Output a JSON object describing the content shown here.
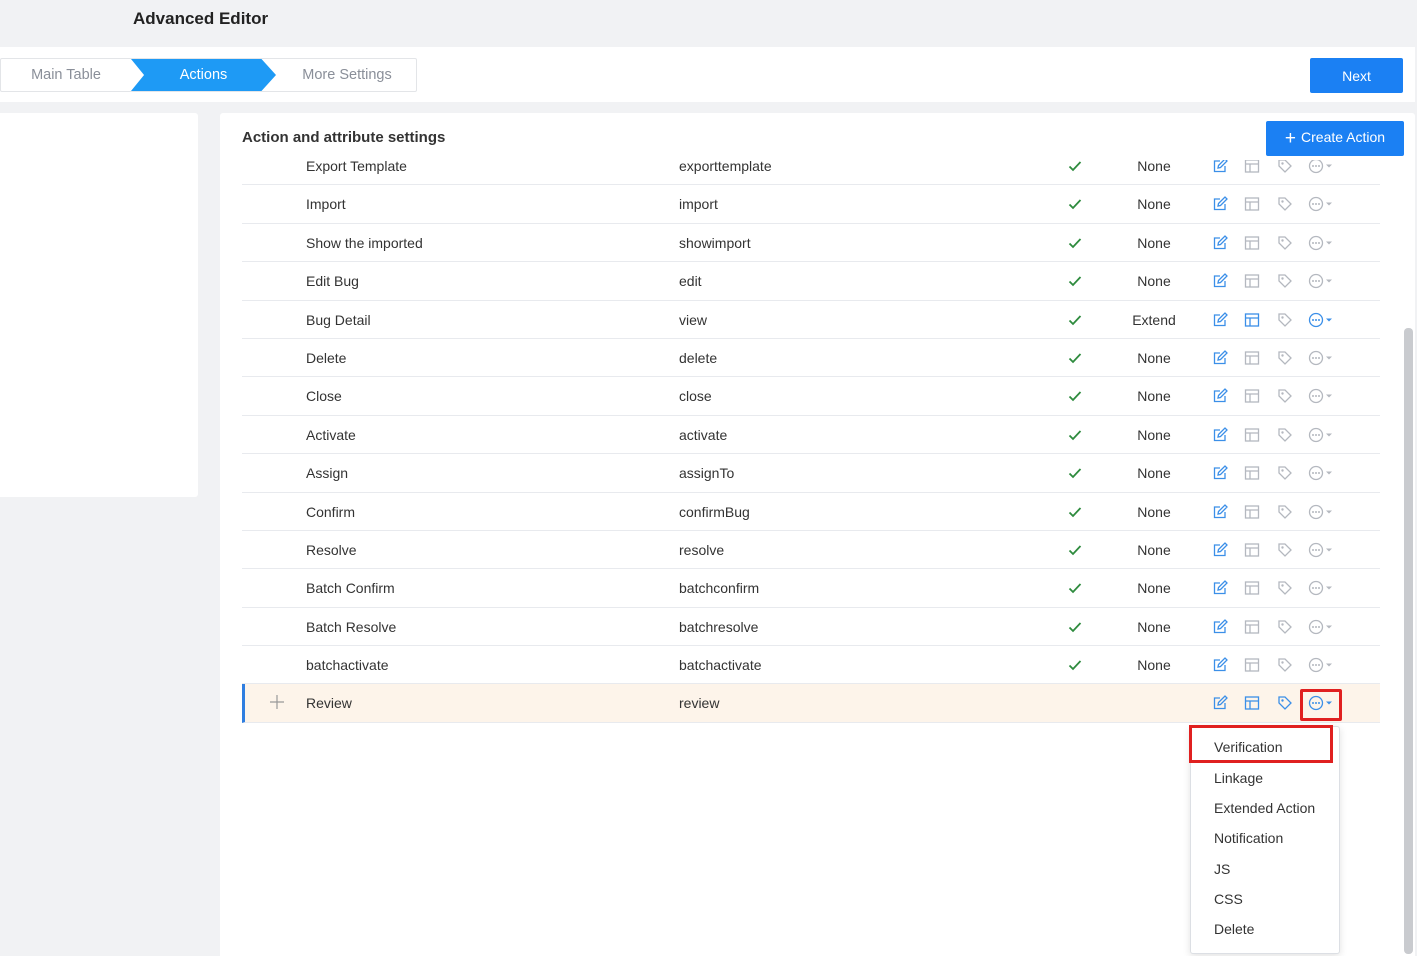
{
  "page": {
    "title": "Advanced Editor"
  },
  "steps": [
    {
      "label": "Main Table"
    },
    {
      "label": "Actions"
    },
    {
      "label": "More Settings"
    }
  ],
  "toolbar": {
    "next_label": "Next"
  },
  "section": {
    "title": "Action and attribute settings",
    "create_label": "Create Action"
  },
  "table": {
    "rows": [
      {
        "name": "Export Template",
        "code": "exporttemplate",
        "enabled": true,
        "extension": "None"
      },
      {
        "name": "Import",
        "code": "import",
        "enabled": true,
        "extension": "None"
      },
      {
        "name": "Show the imported",
        "code": "showimport",
        "enabled": true,
        "extension": "None"
      },
      {
        "name": "Edit Bug",
        "code": "edit",
        "enabled": true,
        "extension": "None"
      },
      {
        "name": "Bug Detail",
        "code": "view",
        "enabled": true,
        "extension": "Extend"
      },
      {
        "name": "Delete",
        "code": "delete",
        "enabled": true,
        "extension": "None"
      },
      {
        "name": "Close",
        "code": "close",
        "enabled": true,
        "extension": "None"
      },
      {
        "name": "Activate",
        "code": "activate",
        "enabled": true,
        "extension": "None"
      },
      {
        "name": "Assign",
        "code": "assignTo",
        "enabled": true,
        "extension": "None"
      },
      {
        "name": "Confirm",
        "code": "confirmBug",
        "enabled": true,
        "extension": "None"
      },
      {
        "name": "Resolve",
        "code": "resolve",
        "enabled": true,
        "extension": "None"
      },
      {
        "name": "Batch Confirm",
        "code": "batchconfirm",
        "enabled": true,
        "extension": "None"
      },
      {
        "name": "Batch Resolve",
        "code": "batchresolve",
        "enabled": true,
        "extension": "None"
      },
      {
        "name": "batchactivate",
        "code": "batchactivate",
        "enabled": true,
        "extension": "None"
      },
      {
        "name": "Review",
        "code": "review",
        "enabled": false,
        "extension": ""
      }
    ]
  },
  "dropdown": {
    "items": [
      "Verification",
      "Linkage",
      "Extended Action",
      "Notification",
      "JS",
      "CSS",
      "Delete"
    ]
  },
  "colors": {
    "accent": "#1b80f3",
    "step_active": "#1e9af5",
    "check": "#2e8b3e",
    "highlight_row": "#fdf4ea",
    "annotation": "#e02020"
  },
  "icons": {
    "check": "check-icon",
    "edit": "edit-icon",
    "layout": "layout-icon",
    "tag": "tag-icon",
    "more": "more-icon",
    "drag": "drag-handle-icon",
    "plus": "plus-icon"
  }
}
